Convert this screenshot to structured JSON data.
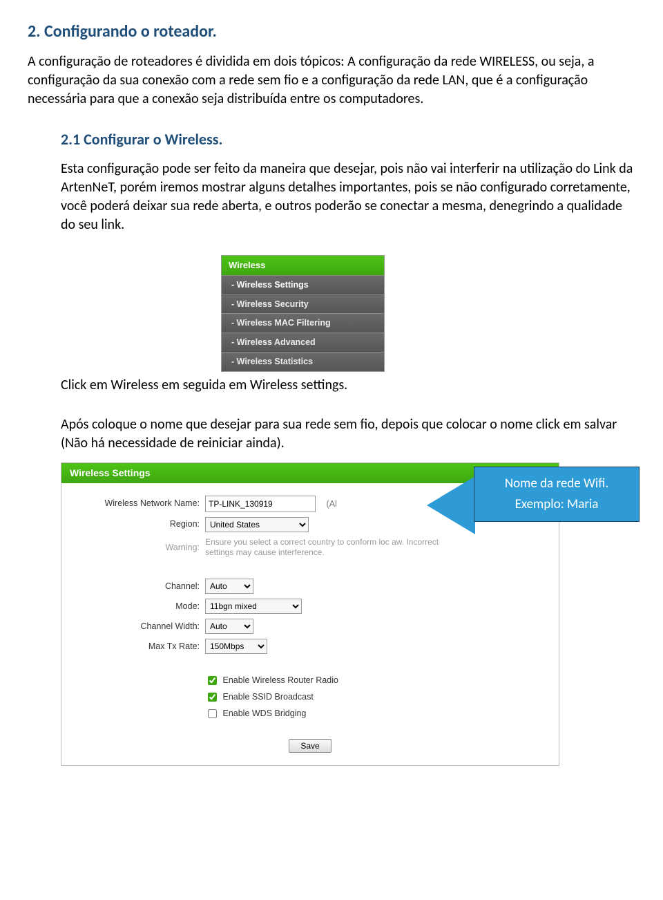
{
  "doc": {
    "title": "2. Configurando o roteador.",
    "intro": "A configuração de roteadores é dividida em dois tópicos: A configuração da rede WIRELESS, ou seja, a configuração da sua conexão com a rede sem fio e a configuração da rede LAN, que é a configuração necessária para que a conexão seja distribuída entre os computadores.",
    "sub": "2.1 Configurar o Wireless.",
    "p1": "Esta configuração pode ser feito da maneira que desejar, pois não vai interferir na utilização do Link da ArtenNeT, porém iremos mostrar alguns detalhes importantes, pois se não configurado corretamente, você poderá deixar sua rede aberta, e outros poderão se conectar a mesma, denegrindo a qualidade do seu link.",
    "p2": "Click em Wireless em seguida em Wireless settings.",
    "p3": "Após coloque o nome que desejar para sua rede sem fio, depois que colocar o nome click em salvar (Não há necessidade de reiniciar ainda)."
  },
  "menu": {
    "header": "Wireless",
    "items": [
      "- Wireless Settings",
      "- Wireless Security",
      "- Wireless MAC Filtering",
      "- Wireless Advanced",
      "- Wireless Statistics"
    ]
  },
  "panel": {
    "header": "Wireless Settings",
    "labels": {
      "name": "Wireless Network Name:",
      "region": "Region:",
      "warning": "Warning:",
      "channel": "Channel:",
      "mode": "Mode:",
      "cwidth": "Channel Width:",
      "maxtx": "Max Tx Rate:"
    },
    "values": {
      "name": "TP-LINK_130919",
      "name_suffix": "(Al",
      "region": "United States",
      "warning_text": "Ensure you select a correct country to conform loc      aw. Incorrect settings may cause interference.",
      "channel": "Auto",
      "mode": "11bgn mixed",
      "cwidth": "Auto",
      "maxtx": "150Mbps"
    },
    "checks": {
      "radio": "Enable Wireless Router Radio",
      "ssid": "Enable SSID Broadcast",
      "wds": "Enable WDS Bridging",
      "radio_checked": true,
      "ssid_checked": true,
      "wds_checked": false
    },
    "save": "Save"
  },
  "callout": {
    "line1": "Nome da rede Wifi.",
    "line2": "Exemplo: Maria"
  }
}
